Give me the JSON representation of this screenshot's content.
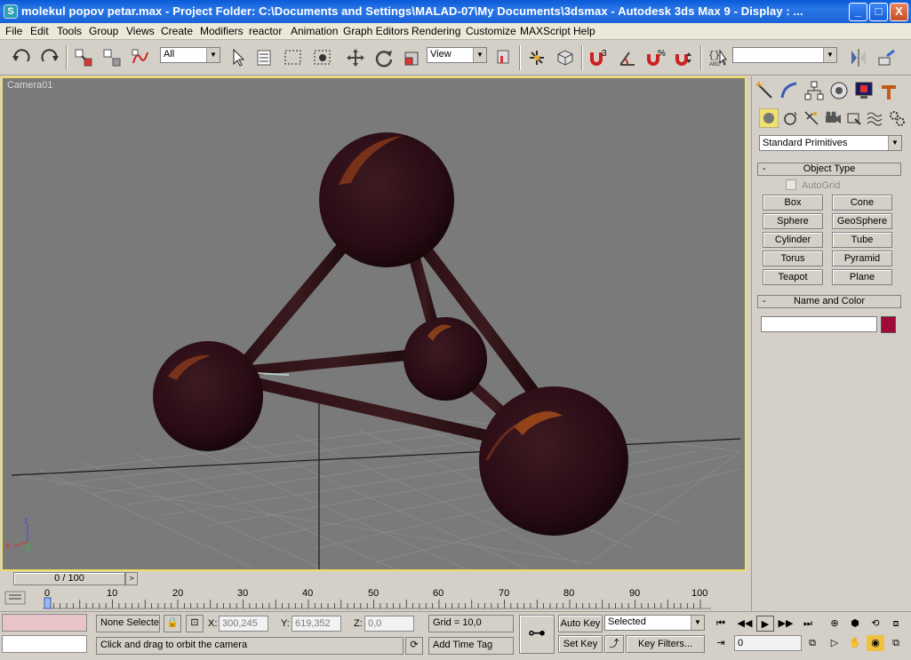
{
  "window": {
    "title": "molekul popov petar.max      - Project Folder: C:\\Documents and Settings\\MALAD-07\\My Documents\\3dsmax      - Autodesk 3ds Max 9      - Display : ...",
    "app_icon": "3ds-max-icon",
    "buttons": {
      "minimize": "_",
      "maximize": "□",
      "close": "X"
    }
  },
  "menu": [
    "File",
    "Edit",
    "Tools",
    "Group",
    "Views",
    "Create",
    "Modifiers",
    "reactor",
    "Animation",
    "Graph Editors",
    "Rendering",
    "Customize",
    "MAXScript",
    "Help"
  ],
  "toolbar": {
    "selection_filter": "All",
    "reference_coord": "View",
    "named_selection": "",
    "icons": [
      "undo-icon",
      "redo-icon",
      "select-and-link-icon",
      "unlink-icon",
      "bind-space-warp-icon",
      "select-object-icon",
      "select-by-name-icon",
      "rectangular-selection-icon",
      "window-crossing-icon",
      "move-icon",
      "rotate-icon",
      "scale-icon",
      "pivot-icon",
      "manipulate-icon",
      "keyboard-shortcut-icon",
      "snap-toggle-icon",
      "angle-snap-icon",
      "percent-snap-icon",
      "spinner-snap-icon",
      "edit-named-selection-icon",
      "mirror-icon",
      "align-icon"
    ],
    "snap_label": "3",
    "percent_label": "%"
  },
  "viewport": {
    "label": "Camera01",
    "axis": {
      "z": "z",
      "x": "x",
      "y": "y"
    }
  },
  "command_panel": {
    "tabs": [
      "create-tab-icon",
      "modify-tab-icon",
      "hierarchy-tab-icon",
      "motion-tab-icon",
      "display-tab-icon",
      "utilities-tab-icon"
    ],
    "categories": [
      "geometry-icon",
      "shapes-icon",
      "lights-icon",
      "cameras-icon",
      "helpers-icon",
      "space-warps-icon",
      "systems-icon"
    ],
    "dropdown": "Standard Primitives",
    "object_type": {
      "title": "Object Type",
      "collapse": "-",
      "autogrid": "AutoGrid",
      "buttons": [
        "Box",
        "Cone",
        "Sphere",
        "GeoSphere",
        "Cylinder",
        "Tube",
        "Torus",
        "Pyramid",
        "Teapot",
        "Plane"
      ]
    },
    "name_and_color": {
      "title": "Name and Color",
      "collapse": "-",
      "name": "",
      "color": "#a00a38"
    }
  },
  "timeline": {
    "slider": "0 / 100",
    "next": ">",
    "ticks": [
      "0",
      "10",
      "20",
      "30",
      "40",
      "50",
      "60",
      "70",
      "80",
      "90",
      "100"
    ]
  },
  "status": {
    "selection": "None Selecte",
    "x_label": "X:",
    "x_value": "300,245",
    "y_label": "Y:",
    "y_value": "619,352",
    "z_label": "Z:",
    "z_value": "0,0",
    "grid": "Grid = 10,0",
    "prompt": "Click and drag to orbit the camera",
    "add_time_tag": "Add Time Tag",
    "auto_key": "Auto Key",
    "set_key": "Set Key",
    "key_mode": "Selected",
    "key_filters": "Key Filters...",
    "current_frame": "0"
  }
}
